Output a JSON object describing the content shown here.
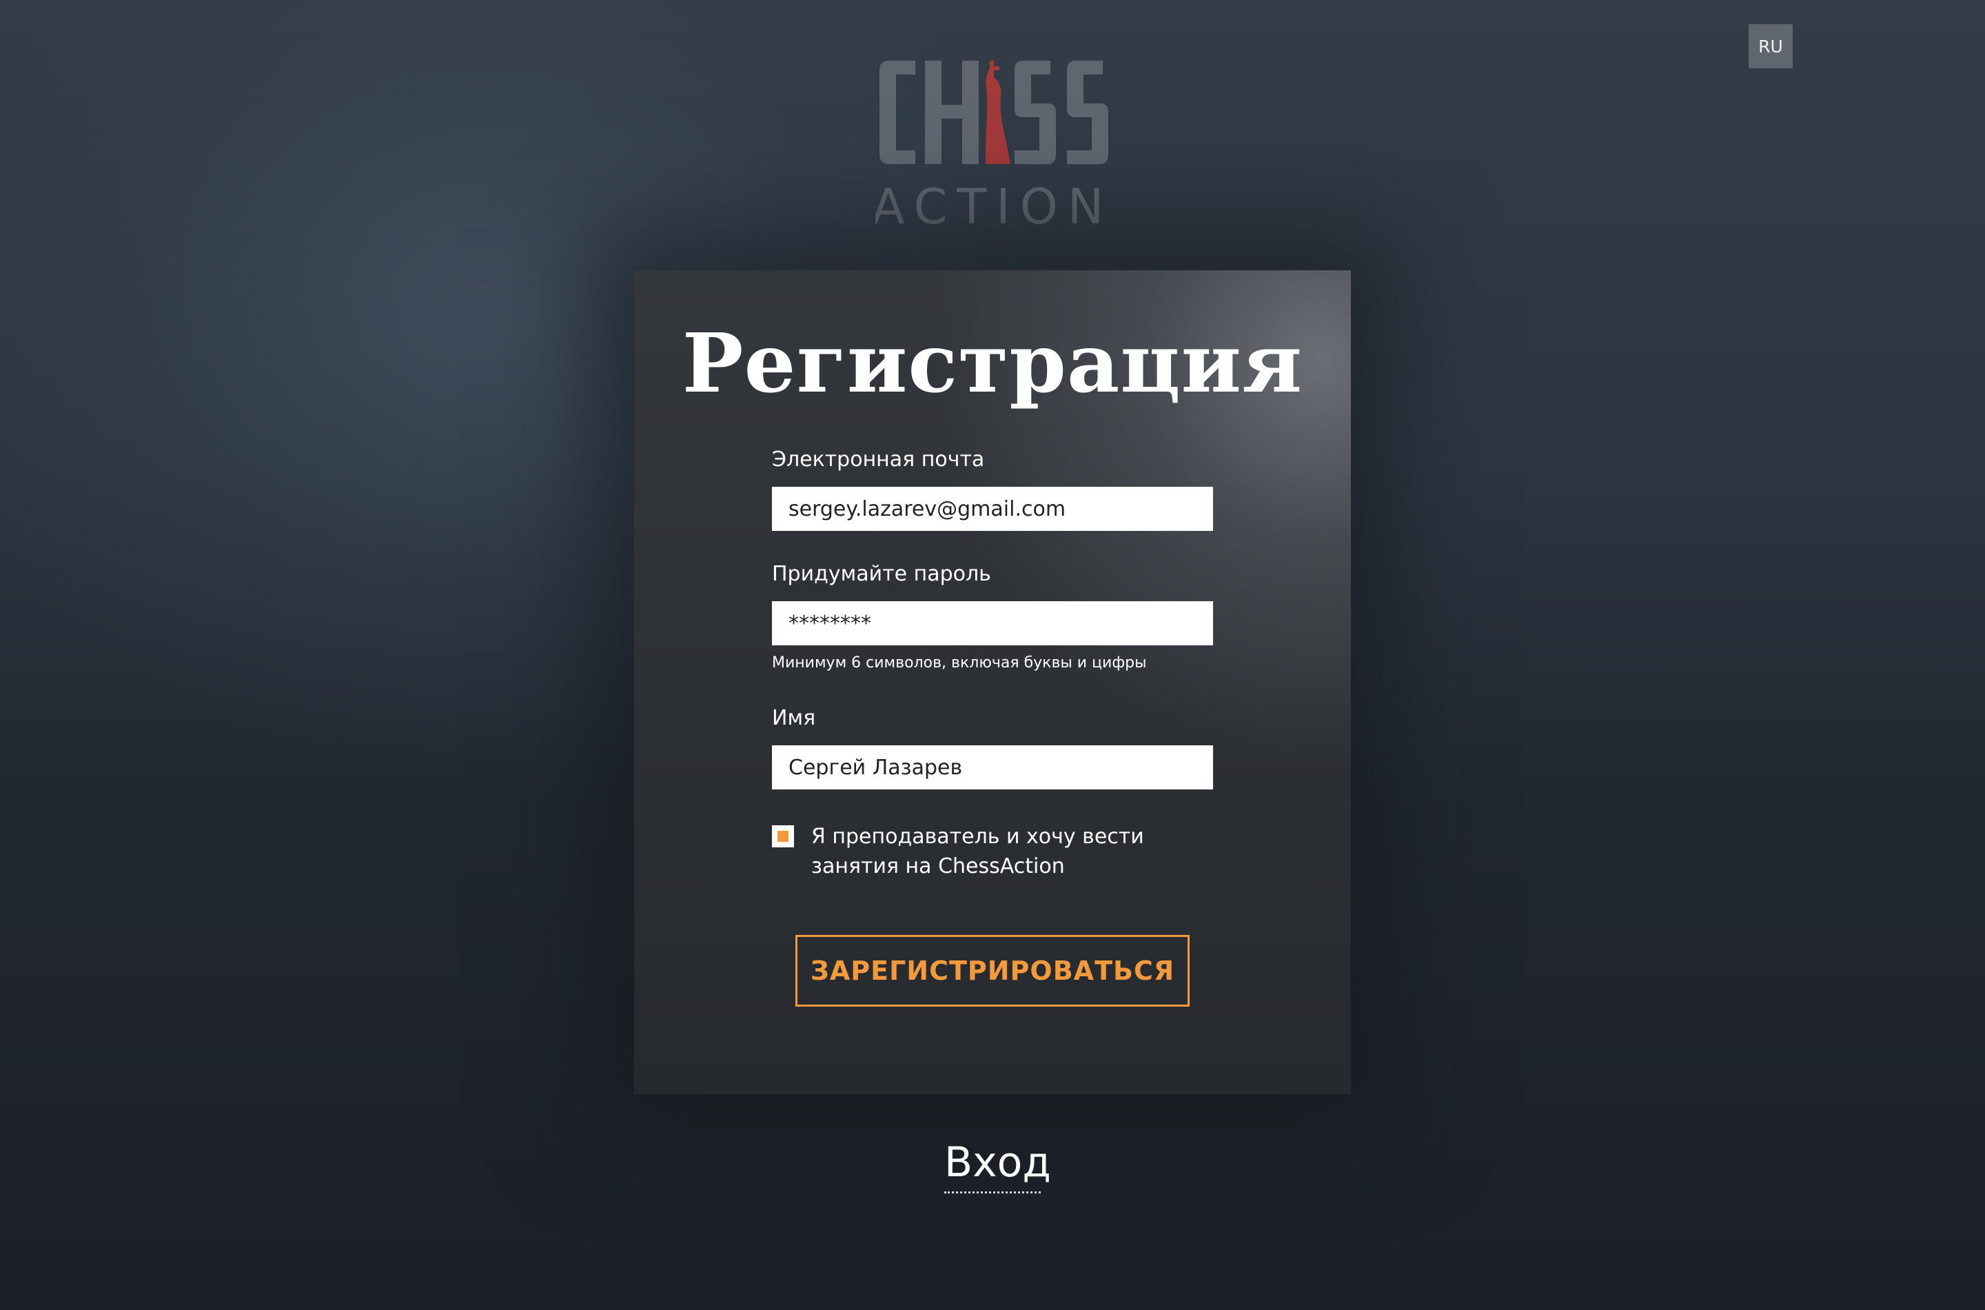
{
  "language": {
    "label": "RU"
  },
  "logo": {
    "line1": "CHESS",
    "line2": "ACTION",
    "icon": "chess-king-icon",
    "text_color": "#5f6670",
    "piece_color": "#a23a3a"
  },
  "form": {
    "title": "Регистрация",
    "email": {
      "label": "Электронная почта",
      "value": "sergey.lazarev@gmail.com"
    },
    "password": {
      "label": "Придумайте пароль",
      "value": "********",
      "hint": "Минимум 6 символов, включая буквы и цифры"
    },
    "name": {
      "label": "Имя",
      "value": "Сергей Лазарев"
    },
    "teacher_checkbox": {
      "label": "Я преподаватель и хочу вести занятия на ChessAction",
      "checked": true
    },
    "submit_label": "ЗАРЕГИСТРИРОВАТЬСЯ"
  },
  "login_link": "Вход",
  "colors": {
    "accent": "#f39a3c",
    "card": "#2c2f34",
    "background": "#252b34"
  }
}
